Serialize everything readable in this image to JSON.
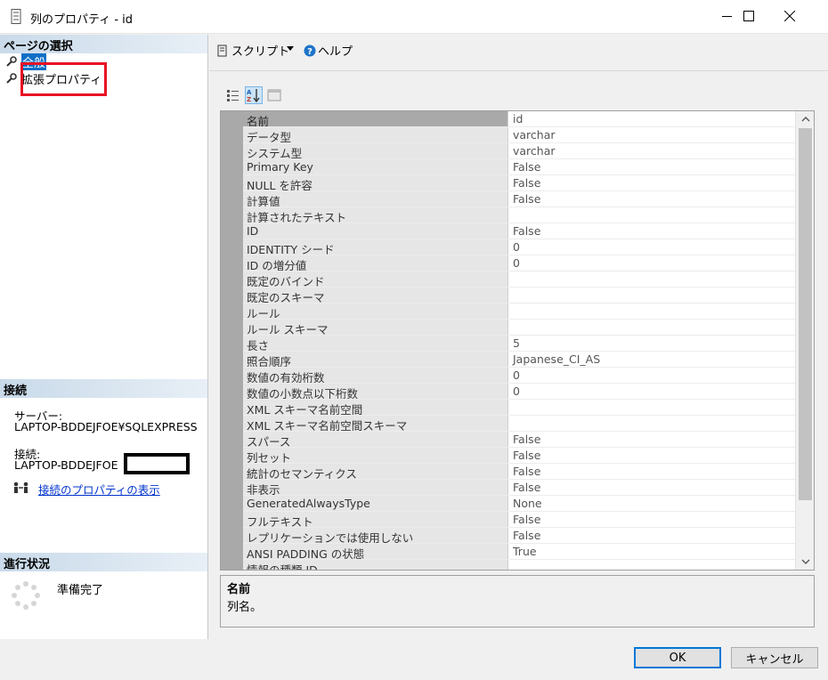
{
  "window": {
    "title": "列のプロパティ - id"
  },
  "left": {
    "pages_header": "ページの選択",
    "pages": [
      {
        "label": "全般"
      },
      {
        "label": "拡張プロパティ"
      }
    ],
    "connection_header": "接続",
    "server_label": "サーバー:",
    "server_value": "LAPTOP-BDDEJFOE¥SQLEXPRESS",
    "connection_label": "接続:",
    "connection_value": "LAPTOP-BDDEJFOE",
    "conn_props_link": "接続のプロパティの表示",
    "progress_header": "進行状況",
    "progress_status": "準備完了"
  },
  "toolbar": {
    "script_label": "スクリプト",
    "help_label": "ヘルプ"
  },
  "properties": [
    {
      "name": "名前",
      "value": "id"
    },
    {
      "name": "データ型",
      "value": "varchar"
    },
    {
      "name": "システム型",
      "value": "varchar"
    },
    {
      "name": "Primary Key",
      "value": "False"
    },
    {
      "name": "NULL を許容",
      "value": "False"
    },
    {
      "name": "計算値",
      "value": "False"
    },
    {
      "name": "計算されたテキスト",
      "value": ""
    },
    {
      "name": "ID",
      "value": "False"
    },
    {
      "name": "IDENTITY シード",
      "value": "0"
    },
    {
      "name": "ID の増分値",
      "value": "0"
    },
    {
      "name": "既定のバインド",
      "value": ""
    },
    {
      "name": "既定のスキーマ",
      "value": ""
    },
    {
      "name": "ルール",
      "value": ""
    },
    {
      "name": "ルール スキーマ",
      "value": ""
    },
    {
      "name": "長さ",
      "value": "5"
    },
    {
      "name": "照合順序",
      "value": "Japanese_CI_AS"
    },
    {
      "name": "数値の有効桁数",
      "value": "0"
    },
    {
      "name": "数値の小数点以下桁数",
      "value": "0"
    },
    {
      "name": "XML スキーマ名前空間",
      "value": ""
    },
    {
      "name": "XML スキーマ名前空間スキーマ",
      "value": ""
    },
    {
      "name": "スパース",
      "value": "False"
    },
    {
      "name": "列セット",
      "value": "False"
    },
    {
      "name": "統計のセマンティクス",
      "value": "False"
    },
    {
      "name": "非表示",
      "value": "False"
    },
    {
      "name": "GeneratedAlwaysType",
      "value": "None"
    },
    {
      "name": "フルテキスト",
      "value": "False"
    },
    {
      "name": "レプリケーションでは使用しない",
      "value": "False"
    },
    {
      "name": "ANSI PADDING の状態",
      "value": "True"
    },
    {
      "name": "情報の種類 ID",
      "value": ""
    }
  ],
  "description": {
    "title": "名前",
    "text": "列名。"
  },
  "buttons": {
    "ok": "OK",
    "cancel": "キャンセル"
  },
  "colors": {
    "accent": "#0078d7",
    "highlight_box": "#e81123",
    "link": "#0033cc"
  }
}
